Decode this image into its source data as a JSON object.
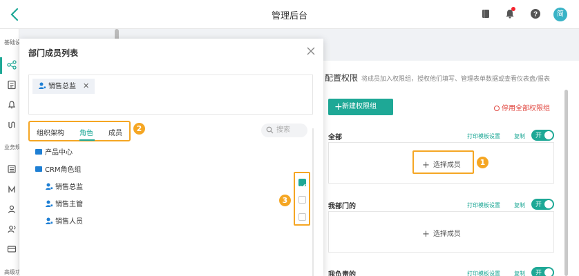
{
  "topbar": {
    "title": "管理后台",
    "avatar_text": "简",
    "icons": [
      "back-icon",
      "book-icon",
      "bell-icon",
      "help-icon"
    ]
  },
  "sidebar": {
    "section_basic": "基础设置",
    "section_business": "业务规则",
    "section_advanced": "高级功能"
  },
  "modal": {
    "title": "部门成员列表",
    "selected_chip": "销售总监",
    "tabs": [
      {
        "label": "组织架构"
      },
      {
        "label": "角色",
        "active": true
      },
      {
        "label": "成员"
      }
    ],
    "search_placeholder": "搜索",
    "tree": [
      {
        "label": "产品中心",
        "type": "folder"
      },
      {
        "label": "CRM角色组",
        "type": "folder"
      },
      {
        "label": "销售总监",
        "type": "role",
        "checked": true
      },
      {
        "label": "销售主管",
        "type": "role",
        "checked": false
      },
      {
        "label": "销售人员",
        "type": "role",
        "checked": false
      }
    ],
    "badges": [
      "2",
      "3"
    ]
  },
  "permissions": {
    "title": "配置权限",
    "desc": "将成员加入权限组，授权他们填写、管理表单数据或查看仪表盘/报表",
    "new_group_button": "新建权限组",
    "stop_all": "停用全部权限组",
    "groups": [
      {
        "name": "全部",
        "print_link": "打印模板设置",
        "copy_link": "复制",
        "toggle": "开",
        "select_label": "选择成员"
      },
      {
        "name": "我部门的",
        "print_link": "打印模板设置",
        "copy_link": "复制",
        "toggle": "开",
        "select_label": "选择成员"
      },
      {
        "name": "我负责的",
        "print_link": "打印模板设置",
        "copy_link": "复制",
        "toggle": "开"
      }
    ],
    "badge": "1"
  },
  "colors": {
    "accent": "#1ea896",
    "highlight": "#f5a623",
    "danger": "#e0463f",
    "link": "#1e7fd4"
  }
}
